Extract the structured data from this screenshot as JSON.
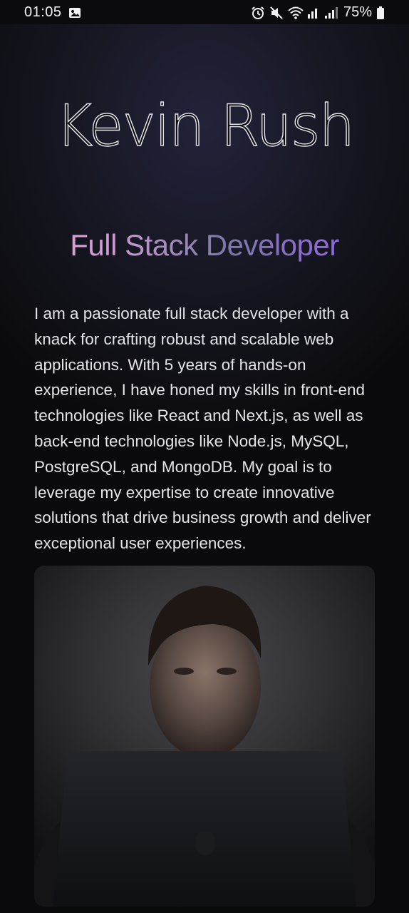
{
  "status_bar": {
    "time": "01:05",
    "battery": "75%",
    "icons": [
      "gallery-icon",
      "alarm-icon",
      "mute-icon",
      "wifi-icon",
      "signal-icon",
      "battery-icon"
    ]
  },
  "hero": {
    "name": "Kevin Rush",
    "role": "Full Stack Developer",
    "bio": "I am a passionate full stack developer with a knack for crafting robust and scalable web applications. With 5 years of hands-on experience, I have honed my skills in front-end technologies like React and Next.js, as well as back-end technologies like Node.js, MySQL, PostgreSQL, and MongoDB. My goal is to leverage my expertise to create innovative solutions that drive business growth and deliver exceptional user experiences."
  },
  "colors": {
    "background": "#0a0a0d",
    "role_gradient": [
      "#f0a6d4",
      "#7c78a6",
      "#a35fe6"
    ],
    "text": "#e3e3e8"
  }
}
